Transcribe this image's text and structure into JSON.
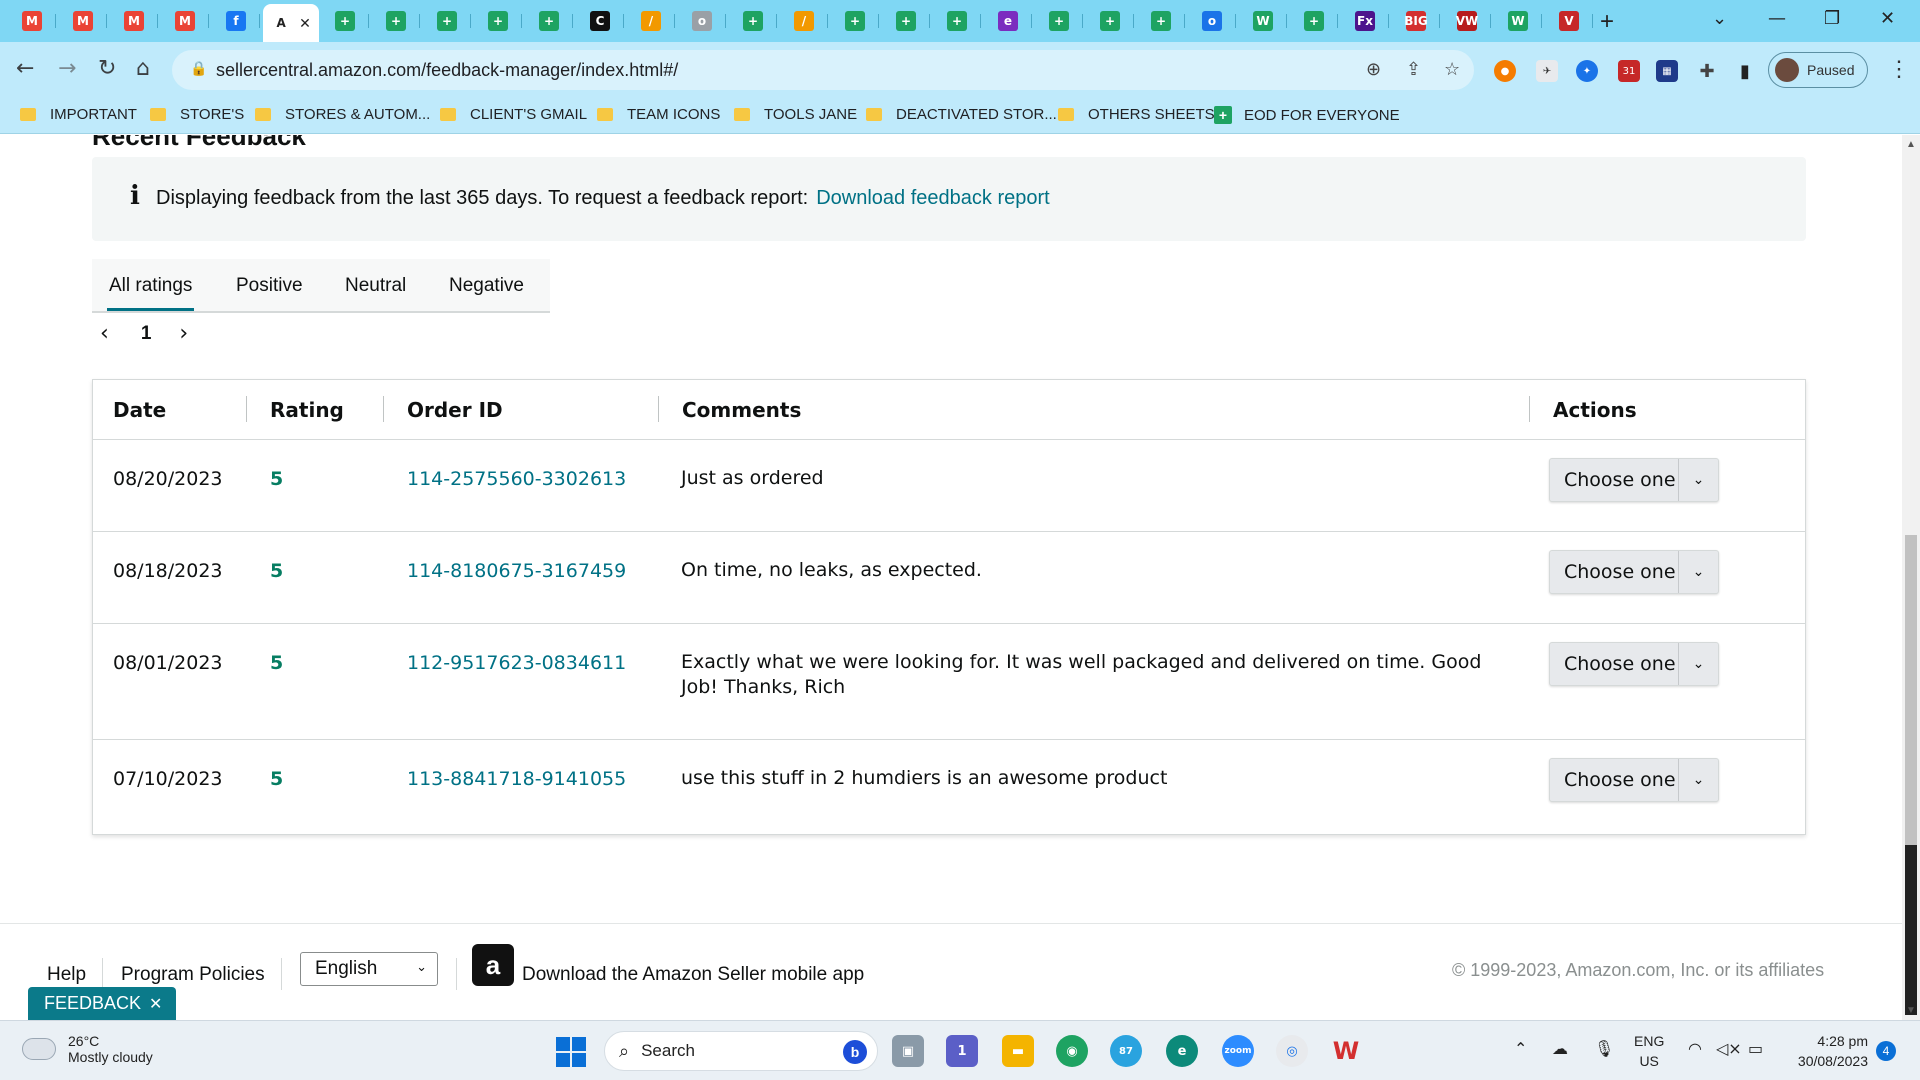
{
  "browser": {
    "tabs": [
      {
        "icon": "gmail-icon",
        "label": "M",
        "color": "#ea4335"
      },
      {
        "icon": "gmail-icon",
        "label": "M",
        "color": "#ea4335"
      },
      {
        "icon": "gmail-icon",
        "label": "M",
        "color": "#ea4335"
      },
      {
        "icon": "gmail-icon",
        "label": "M",
        "color": "#ea4335"
      },
      {
        "icon": "facebook-icon",
        "label": "f",
        "color": "#1877f2"
      },
      {
        "icon": "amazon-icon",
        "label": "A",
        "color": "#ffffff",
        "active": true
      },
      {
        "icon": "sheets-icon",
        "label": "+",
        "color": "#1ea362"
      },
      {
        "icon": "sheets-icon",
        "label": "+",
        "color": "#1ea362"
      },
      {
        "icon": "sheets-icon",
        "label": "+",
        "color": "#1ea362"
      },
      {
        "icon": "sheets-icon",
        "label": "+",
        "color": "#1ea362"
      },
      {
        "icon": "sheets-icon",
        "label": "+",
        "color": "#1ea362"
      },
      {
        "icon": "c-icon",
        "label": "C",
        "color": "#111111"
      },
      {
        "icon": "pencil-icon",
        "label": "/",
        "color": "#f29900"
      },
      {
        "icon": "globe-icon",
        "label": "o",
        "color": "#9aa0a6"
      },
      {
        "icon": "sheets-icon",
        "label": "+",
        "color": "#1ea362"
      },
      {
        "icon": "pencil-icon",
        "label": "/",
        "color": "#f29900"
      },
      {
        "icon": "sheets-icon",
        "label": "+",
        "color": "#1ea362"
      },
      {
        "icon": "sheets-icon",
        "label": "+",
        "color": "#1ea362"
      },
      {
        "icon": "sheets-icon",
        "label": "+",
        "color": "#1ea362"
      },
      {
        "icon": "chat-icon",
        "label": "e",
        "color": "#7b2cbf"
      },
      {
        "icon": "sheets-icon",
        "label": "+",
        "color": "#1ea362"
      },
      {
        "icon": "sheets-icon",
        "label": "+",
        "color": "#1ea362"
      },
      {
        "icon": "sheets-icon",
        "label": "+",
        "color": "#1ea362"
      },
      {
        "icon": "compass-icon",
        "label": "o",
        "color": "#1a73e8"
      },
      {
        "icon": "w-icon",
        "label": "W",
        "color": "#1ea362"
      },
      {
        "icon": "sheets-icon",
        "label": "+",
        "color": "#1ea362"
      },
      {
        "icon": "fedex-icon",
        "label": "Fx",
        "color": "#4d148c"
      },
      {
        "icon": "big-icon",
        "label": "BIG",
        "color": "#d32f2f"
      },
      {
        "icon": "vw-icon",
        "label": "VW",
        "color": "#b71c1c"
      },
      {
        "icon": "w-icon",
        "label": "W",
        "color": "#1ea362"
      },
      {
        "icon": "shield-icon",
        "label": "V",
        "color": "#c62828"
      }
    ],
    "url": "sellercentral.amazon.com/feedback-manager/index.html#/",
    "profile_status": "Paused",
    "bookmarks": [
      {
        "label": "IMPORTANT",
        "kind": "folder"
      },
      {
        "label": "STORE'S",
        "kind": "folder"
      },
      {
        "label": "STORES & AUTOM...",
        "kind": "folder"
      },
      {
        "label": "CLIENT'S GMAIL",
        "kind": "folder"
      },
      {
        "label": "TEAM ICONS",
        "kind": "folder"
      },
      {
        "label": "TOOLS JANE",
        "kind": "folder"
      },
      {
        "label": "DEACTIVATED STOR...",
        "kind": "folder"
      },
      {
        "label": "OTHERS SHEETS",
        "kind": "folder"
      },
      {
        "label": "EOD FOR EVERYONE",
        "kind": "sheet"
      }
    ],
    "extension_badge": "31"
  },
  "page": {
    "section_title_cut": "Recent Feedback",
    "info": {
      "icon": "i",
      "message": "Displaying feedback from the last 365 days. To request a feedback report:",
      "link": "Download feedback report"
    },
    "rating_tabs": [
      "All ratings",
      "Positive",
      "Neutral",
      "Negative"
    ],
    "pager": {
      "prev": "‹",
      "page": "1",
      "next": "›"
    },
    "table": {
      "headers": [
        "Date",
        "Rating",
        "Order ID",
        "Comments",
        "Actions"
      ],
      "rows": [
        {
          "date": "08/20/2023",
          "rating": "5",
          "order_id": "114-2575560-3302613",
          "comment": "Just as ordered",
          "action": "Choose one"
        },
        {
          "date": "08/18/2023",
          "rating": "5",
          "order_id": "114-8180675-3167459",
          "comment": "On time, no leaks, as expected.",
          "action": "Choose one"
        },
        {
          "date": "08/01/2023",
          "rating": "5",
          "order_id": "112-9517623-0834611",
          "comment": "Exactly what we were looking for. It was well packaged and delivered on time. Good Job! Thanks, Rich",
          "action": "Choose one"
        },
        {
          "date": "07/10/2023",
          "rating": "5",
          "order_id": "113-8841718-9141055",
          "comment": "use this stuff in 2 humdiers is an awesome product",
          "action": "Choose one"
        }
      ]
    },
    "footer": {
      "help": "Help",
      "policies": "Program Policies",
      "language": "English",
      "app_logo": "a",
      "app_text": "Download the Amazon Seller mobile app",
      "copyright": "© 1999-2023, Amazon.com, Inc. or its affiliates"
    },
    "feedback_button": "FEEDBACK"
  },
  "taskbar": {
    "temperature": "26°C",
    "weather": "Mostly cloudy",
    "search_placeholder": "Search",
    "bing_label": "b",
    "lang_line1": "ENG",
    "lang_line2": "US",
    "time": "4:28 pm",
    "date": "30/08/2023",
    "notification_count": "4",
    "telegram_badge": "87",
    "teams_badge": "1"
  },
  "colors": {
    "link": "#007185",
    "rating_green": "#067d62",
    "chrome_frame": "#7fd7f4",
    "feedback_button": "#0b7a8a"
  }
}
